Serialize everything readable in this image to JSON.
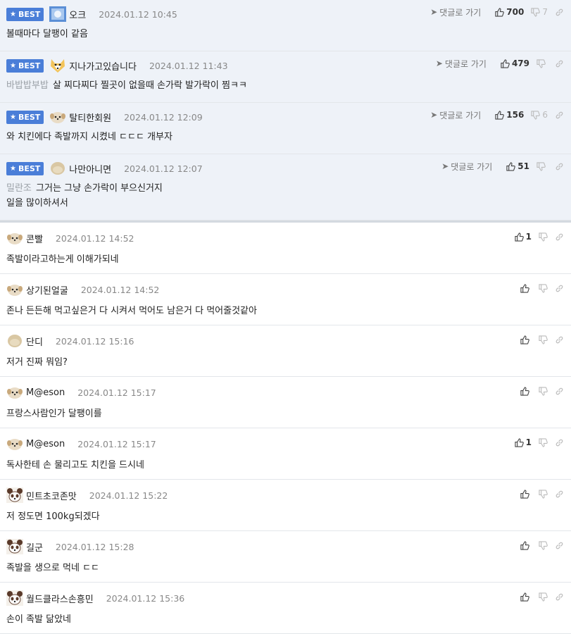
{
  "best_badge_label": "BEST",
  "goto_label": "댓글로 가기",
  "colors": {
    "accent": "#4a7ed8",
    "best_bg": "#eef2f8"
  },
  "best_comments": [
    {
      "nick": "오크",
      "date": "2024.01.12 10:45",
      "avatar": "blue-avatar-icon",
      "mention": "",
      "lines": [
        "볼때마다 달팽이 같음"
      ],
      "up": "700",
      "down": "7"
    },
    {
      "nick": "지나가고있습니다",
      "date": "2024.01.12 11:43",
      "avatar": "dog-avatar-icon",
      "mention": "바밥밥부밥",
      "lines": [
        "살 찌다찌다 찔곳이 없을때 손가락 발가락이 찜ㅋㅋ"
      ],
      "up": "479",
      "down": ""
    },
    {
      "nick": "탈티한회원",
      "date": "2024.01.12 12:09",
      "avatar": "puppy-avatar-icon",
      "mention": "",
      "lines": [
        "와 치킨에다 족발까지 시켰네 ㄷㄷㄷ 개부자"
      ],
      "up": "156",
      "down": "6"
    },
    {
      "nick": "나만아니면",
      "date": "2024.01.12 12:07",
      "avatar": "blob-avatar-icon",
      "mention": "밀란조",
      "lines": [
        "그거는 그냥 손가락이 부으신거지",
        "일을 많이하셔서"
      ],
      "up": "51",
      "down": ""
    }
  ],
  "comments": [
    {
      "nick": "콘빨",
      "date": "2024.01.12 14:52",
      "avatar": "puppy-avatar-icon",
      "text": "족발이라고하는게 이해가되네",
      "up": "1"
    },
    {
      "nick": "상기된얼굴",
      "date": "2024.01.12 14:52",
      "avatar": "puppy-avatar-icon",
      "text": "존나 든든해 먹고싶은거 다 시켜서 먹어도 남은거 다 먹어줄것같아",
      "up": ""
    },
    {
      "nick": "단디",
      "date": "2024.01.12 15:16",
      "avatar": "blob-avatar-icon",
      "text": "저거 진짜 뭐임?",
      "up": ""
    },
    {
      "nick": "M@eson",
      "date": "2024.01.12 15:17",
      "avatar": "puppy-avatar-icon",
      "text": "프랑스사람인가 달팽이를",
      "up": ""
    },
    {
      "nick": "M@eson",
      "date": "2024.01.12 15:17",
      "avatar": "puppy-avatar-icon",
      "text": "독사한테 손 물리고도 치킨을 드시네",
      "up": "1"
    },
    {
      "nick": "민트초코존맛",
      "date": "2024.01.12 15:22",
      "avatar": "panda-avatar-icon",
      "text": "저 정도면 100kg되겠다",
      "up": ""
    },
    {
      "nick": "길군",
      "date": "2024.01.12 15:28",
      "avatar": "panda-avatar-icon",
      "text": "족발을 생으로 먹네 ㄷㄷ",
      "up": ""
    },
    {
      "nick": "월드클라스손흥민",
      "date": "2024.01.12 15:36",
      "avatar": "panda-avatar-icon",
      "text": "손이 족발 닮았네",
      "up": ""
    }
  ]
}
